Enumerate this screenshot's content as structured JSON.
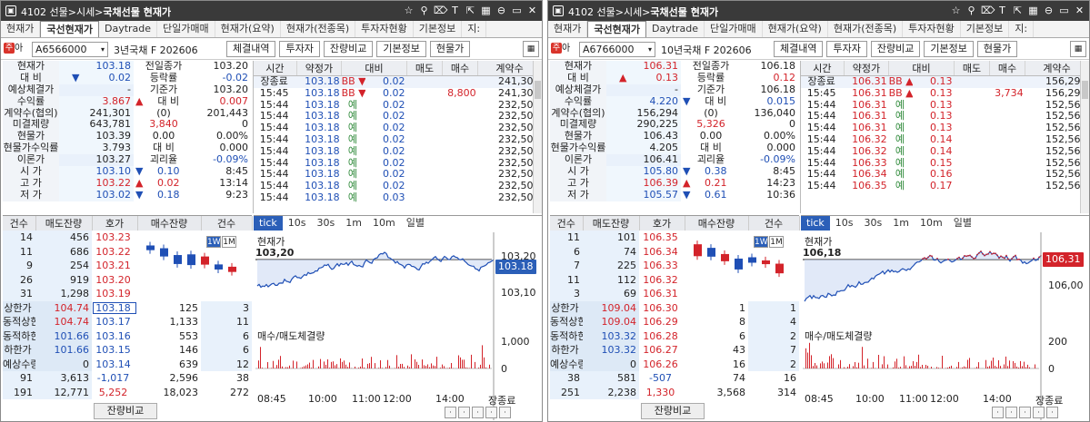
{
  "windows": [
    {
      "title_prefix": "4102 선물>시세>",
      "title_bold": "국채선물 현재가",
      "tabs": [
        "현재가",
        "국선현재가",
        "Daytrade",
        "단일가매매",
        "현재가(요약)",
        "현재가(전종목)",
        "투자자현황",
        "기본정보",
        "지:"
      ],
      "active_tab": 1,
      "acct_label": "아",
      "acct_badge": "주",
      "code": "A6566000",
      "name": "3년국채 F 202606",
      "buttons": [
        "체결내역",
        "투자자",
        "잔량비교",
        "기본정보",
        "현물가"
      ],
      "quote": [
        {
          "l1": "현재가",
          "v1": "103.18",
          "c1": "blue",
          "a1": "",
          "l2": "전일종가",
          "v2": "103.20",
          "c2": "",
          "a2": ""
        },
        {
          "l1": "대    비",
          "v1": "0.02",
          "c1": "blue",
          "a1": "▼",
          "l2": "등락률",
          "v2": "-0.02",
          "c2": "blue",
          "a2": ""
        },
        {
          "l1": "예상체결가",
          "v1": "-",
          "c1": "",
          "a1": "",
          "l2": "기준가",
          "v2": "103.20",
          "c2": "",
          "a2": ""
        },
        {
          "l1": "수익률",
          "v1": "3.867",
          "c1": "red",
          "a1": "",
          "l2": "대    비",
          "v2": "0.007",
          "c2": "red",
          "a2": "▲"
        },
        {
          "l1": "계약수(협의)",
          "v1": "241,301",
          "c1": "",
          "a1": "",
          "l2": "(0)",
          "v2": "201,443",
          "c2": "",
          "a2": ""
        },
        {
          "l1": "미결제량",
          "v1": "643,781",
          "c1": "",
          "a1": "",
          "l2": "3,840",
          "v2": "0",
          "c2": "",
          "a2": "",
          "l2c": "red"
        },
        {
          "l1": "현물가",
          "v1": "103.39",
          "c1": "",
          "a1": "",
          "l2": "0.00",
          "v2": "0.00%",
          "c2": "",
          "a2": ""
        },
        {
          "l1": "현물가수익률",
          "v1": "3.793",
          "c1": "",
          "a1": "",
          "l2": "대    비",
          "v2": "0.000",
          "c2": "",
          "a2": ""
        },
        {
          "l1": "이론가",
          "v1": "103.27",
          "c1": "",
          "a1": "",
          "l2": "괴리율",
          "v2": "-0.09%",
          "c2": "blue",
          "a2": ""
        },
        {
          "l1": "시    가",
          "v1": "103.10",
          "c1": "blue",
          "a1": "",
          "l2": "0.10",
          "v2": "8:45",
          "c2": "",
          "a2": "▼",
          "l2c": "blue"
        },
        {
          "l1": "고    가",
          "v1": "103.22",
          "c1": "red",
          "a1": "",
          "l2": "0.02",
          "v2": "13:14",
          "c2": "",
          "a2": "▲",
          "l2c": "red"
        },
        {
          "l1": "저    가",
          "v1": "103.02",
          "c1": "blue",
          "a1": "",
          "l2": "0.18",
          "v2": "9:23",
          "c2": "",
          "a2": "▼",
          "l2c": "blue"
        }
      ],
      "tick_headers": [
        "시간",
        "약정가",
        "대비",
        "매도",
        "매수",
        "계약수"
      ],
      "ticks": [
        [
          "장종료",
          "103.18",
          "BB ▼",
          "0.02",
          "",
          "",
          "241,301"
        ],
        [
          "15:45",
          "103.18",
          "BB ▼",
          "0.02",
          "",
          "8,800",
          "241,301"
        ],
        [
          "15:44",
          "103.18",
          "예",
          "0.02",
          "",
          "",
          "232,501"
        ],
        [
          "15:44",
          "103.18",
          "예",
          "0.02",
          "",
          "",
          "232,501"
        ],
        [
          "15:44",
          "103.18",
          "예",
          "0.02",
          "",
          "",
          "232,501"
        ],
        [
          "15:44",
          "103.18",
          "예",
          "0.02",
          "",
          "",
          "232,501"
        ],
        [
          "15:44",
          "103.18",
          "예",
          "0.02",
          "",
          "",
          "232,501"
        ],
        [
          "15:44",
          "103.18",
          "예",
          "0.02",
          "",
          "",
          "232,501"
        ],
        [
          "15:44",
          "103.18",
          "예",
          "0.02",
          "",
          "",
          "232,501"
        ],
        [
          "15:44",
          "103.18",
          "예",
          "0.02",
          "",
          "",
          "232,501"
        ],
        [
          "15:44",
          "103.18",
          "예",
          "0.03",
          "",
          "",
          "232,501"
        ]
      ],
      "ob_headers": [
        "건수",
        "매도잔량",
        "호가",
        "매수잔량",
        "건수"
      ],
      "asks": [
        [
          "14",
          "456",
          "103.23"
        ],
        [
          "11",
          "686",
          "103.22"
        ],
        [
          "9",
          "254",
          "103.21"
        ],
        [
          "26",
          "919",
          "103.20"
        ],
        [
          "31",
          "1,298",
          "103.19"
        ]
      ],
      "bids": [
        {
          "lab": "상한가",
          "lv": "104.74",
          "lvc": "red",
          "p": "103.18",
          "bq": "125",
          "bc": "3",
          "boxed": true
        },
        {
          "lab": "동적상한",
          "lv": "104.74",
          "lvc": "red",
          "p": "103.17",
          "bq": "1,133",
          "bc": "11"
        },
        {
          "lab": "동적하한",
          "lv": "101.66",
          "lvc": "blue",
          "p": "103.16",
          "bq": "553",
          "bc": "6"
        },
        {
          "lab": "하한가",
          "lv": "101.66",
          "lvc": "blue",
          "p": "103.15",
          "bq": "146",
          "bc": "6"
        },
        {
          "lab": "예상수량",
          "lv": "0",
          "lvc": "",
          "p": "103.14",
          "bq": "639",
          "bc": "12"
        }
      ],
      "ob_tot": [
        "91",
        "3,613",
        "-1,017",
        "2,596",
        "38"
      ],
      "ob_tot2": [
        "191",
        "12,771",
        "5,252",
        "18,023",
        "272"
      ],
      "ob_tot2c": "red",
      "ob_tot1c": "blue",
      "compare_label": "잔량비교",
      "wm": [
        "1W",
        "1M"
      ],
      "timeframes": [
        "tick",
        "10s",
        "30s",
        "1m",
        "10m",
        "일별"
      ],
      "chart_title": "현재가",
      "vol_title": "매수/매도체결량",
      "ref_label": "103,20",
      "cur_price": "103.18",
      "y_labels": [
        "103,20",
        "103,10"
      ],
      "vol_labels": [
        "1,000",
        "0"
      ],
      "x_labels": [
        "08:45",
        "10:00",
        "11:00",
        "12:00",
        "14:00",
        "장종료"
      ],
      "price_above_ref": false
    },
    {
      "title_prefix": "4102 선물>시세>",
      "title_bold": "국채선물 현재가",
      "tabs": [
        "현재가",
        "국선현재가",
        "Daytrade",
        "단일가매매",
        "현재가(요약)",
        "현재가(전종목)",
        "투자자현황",
        "기본정보",
        "지:"
      ],
      "active_tab": 1,
      "acct_label": "아",
      "acct_badge": "주",
      "code": "A6766000",
      "name": "10년국채 F 202606",
      "buttons": [
        "체결내역",
        "투자자",
        "잔량비교",
        "기본정보",
        "현물가"
      ],
      "quote": [
        {
          "l1": "현재가",
          "v1": "106.31",
          "c1": "red",
          "a1": "",
          "l2": "전일종가",
          "v2": "106.18",
          "c2": "",
          "a2": ""
        },
        {
          "l1": "대    비",
          "v1": "0.13",
          "c1": "red",
          "a1": "▲",
          "l2": "등락률",
          "v2": "0.12",
          "c2": "red",
          "a2": ""
        },
        {
          "l1": "예상체결가",
          "v1": "-",
          "c1": "",
          "a1": "",
          "l2": "기준가",
          "v2": "106.18",
          "c2": "",
          "a2": ""
        },
        {
          "l1": "수익률",
          "v1": "4.220",
          "c1": "blue",
          "a1": "",
          "l2": "대    비",
          "v2": "0.015",
          "c2": "blue",
          "a2": "▼"
        },
        {
          "l1": "계약수(협의)",
          "v1": "156,294",
          "c1": "",
          "a1": "",
          "l2": "(0)",
          "v2": "136,040",
          "c2": "",
          "a2": ""
        },
        {
          "l1": "미결제량",
          "v1": "290,225",
          "c1": "",
          "a1": "",
          "l2": "5,326",
          "v2": "0",
          "c2": "",
          "a2": "",
          "l2c": "red"
        },
        {
          "l1": "현물가",
          "v1": "106.43",
          "c1": "",
          "a1": "",
          "l2": "0.00",
          "v2": "0.00%",
          "c2": "",
          "a2": ""
        },
        {
          "l1": "현물가수익률",
          "v1": "4.205",
          "c1": "",
          "a1": "",
          "l2": "대    비",
          "v2": "0.000",
          "c2": "",
          "a2": ""
        },
        {
          "l1": "이론가",
          "v1": "106.41",
          "c1": "",
          "a1": "",
          "l2": "괴리율",
          "v2": "-0.09%",
          "c2": "blue",
          "a2": ""
        },
        {
          "l1": "시    가",
          "v1": "105.80",
          "c1": "blue",
          "a1": "",
          "l2": "0.38",
          "v2": "8:45",
          "c2": "",
          "a2": "▼",
          "l2c": "blue"
        },
        {
          "l1": "고    가",
          "v1": "106.39",
          "c1": "red",
          "a1": "",
          "l2": "0.21",
          "v2": "14:23",
          "c2": "",
          "a2": "▲",
          "l2c": "red"
        },
        {
          "l1": "저    가",
          "v1": "105.57",
          "c1": "blue",
          "a1": "",
          "l2": "0.61",
          "v2": "10:36",
          "c2": "",
          "a2": "▼",
          "l2c": "blue"
        }
      ],
      "tick_headers": [
        "시간",
        "약정가",
        "대비",
        "매도",
        "매수",
        "계약수"
      ],
      "ticks": [
        [
          "장종료",
          "106.31",
          "BB ▲",
          "0.13",
          "",
          "",
          "156,294"
        ],
        [
          "15:45",
          "106.31",
          "BB ▲",
          "0.13",
          "",
          "3,734",
          "156,294"
        ],
        [
          "15:44",
          "106.31",
          "예",
          "0.13",
          "",
          "",
          "152,560"
        ],
        [
          "15:44",
          "106.31",
          "예",
          "0.13",
          "",
          "",
          "152,560"
        ],
        [
          "15:44",
          "106.31",
          "예",
          "0.13",
          "",
          "",
          "152,560"
        ],
        [
          "15:44",
          "106.32",
          "예",
          "0.14",
          "",
          "",
          "152,560"
        ],
        [
          "15:44",
          "106.32",
          "예",
          "0.14",
          "",
          "",
          "152,560"
        ],
        [
          "15:44",
          "106.33",
          "예",
          "0.15",
          "",
          "",
          "152,560"
        ],
        [
          "15:44",
          "106.34",
          "예",
          "0.16",
          "",
          "",
          "152,560"
        ],
        [
          "15:44",
          "106.35",
          "예",
          "0.17",
          "",
          "",
          "152,560"
        ]
      ],
      "ob_headers": [
        "건수",
        "매도잔량",
        "호가",
        "매수잔량",
        "건수"
      ],
      "asks": [
        [
          "11",
          "101",
          "106.35"
        ],
        [
          "6",
          "74",
          "106.34"
        ],
        [
          "7",
          "225",
          "106.33"
        ],
        [
          "11",
          "112",
          "106.32"
        ],
        [
          "3",
          "69",
          "106.31"
        ]
      ],
      "bids": [
        {
          "lab": "상한가",
          "lv": "109.04",
          "lvc": "red",
          "p": "106.30",
          "bq": "1",
          "bc": "1"
        },
        {
          "lab": "동적상한",
          "lv": "109.04",
          "lvc": "red",
          "p": "106.29",
          "bq": "8",
          "bc": "4"
        },
        {
          "lab": "동적하한",
          "lv": "103.32",
          "lvc": "blue",
          "p": "106.28",
          "bq": "6",
          "bc": "2"
        },
        {
          "lab": "하한가",
          "lv": "103.32",
          "lvc": "blue",
          "p": "106.27",
          "bq": "43",
          "bc": "7"
        },
        {
          "lab": "예상수량",
          "lv": "0",
          "lvc": "",
          "p": "106.26",
          "bq": "16",
          "bc": "2"
        }
      ],
      "ob_tot": [
        "38",
        "581",
        "-507",
        "74",
        "16"
      ],
      "ob_tot2": [
        "251",
        "2,238",
        "1,330",
        "3,568",
        "314"
      ],
      "ob_tot2c": "red",
      "ob_tot1c": "blue",
      "compare_label": "잔량비교",
      "wm": [
        "1W",
        "1M"
      ],
      "timeframes": [
        "tick",
        "10s",
        "30s",
        "1m",
        "10m",
        "일별"
      ],
      "chart_title": "현재가",
      "vol_title": "매수/매도체결량",
      "ref_label": "106,18",
      "cur_price": "106,31",
      "y_labels": [
        "106,00"
      ],
      "vol_labels": [
        "200",
        "0"
      ],
      "x_labels": [
        "08:45",
        "10:00",
        "11:00",
        "12:00",
        "14:00",
        "장종료"
      ],
      "price_above_ref": true
    }
  ],
  "colors": {
    "up": "#d3232a",
    "down": "#1f4fb5",
    "active_tab_bg": "#2b5fb8",
    "titlebar": "#3a3a3a"
  },
  "icons": [
    "star-icon",
    "ruler-icon",
    "link-icon",
    "text-icon",
    "share-icon",
    "grid-icon",
    "minimize-icon",
    "restore-icon",
    "close-icon"
  ]
}
